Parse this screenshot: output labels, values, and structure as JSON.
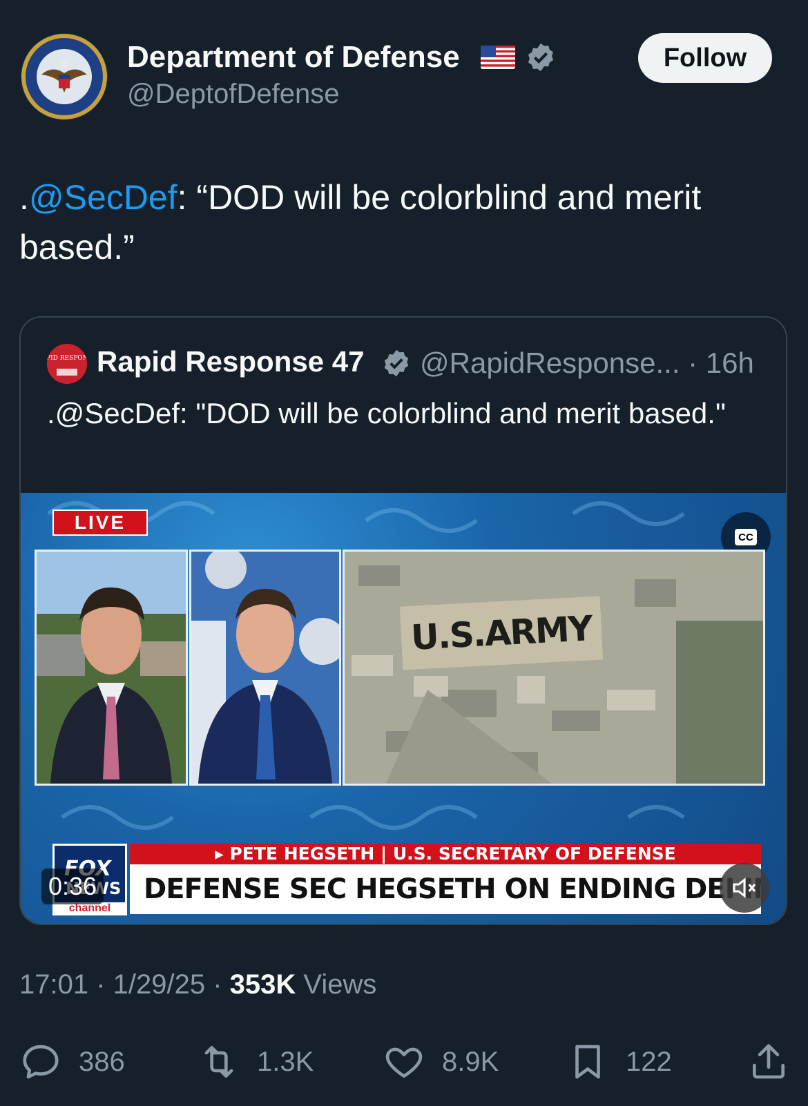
{
  "author": {
    "display_name": "Department of Defense",
    "handle": "@DeptofDefense",
    "follow_label": "Follow"
  },
  "tweet": {
    "prefix": ".",
    "mention": "@SecDef",
    "text": ": “DOD will be colorblind and merit based.”"
  },
  "quoted": {
    "display_name": "Rapid Response 47",
    "handle_time": "@RapidResponse... · 16h",
    "text": ".@SecDef: \"DOD will be colorblind and merit based.\"",
    "avatar_text": "RAPID RESPONSE"
  },
  "video": {
    "live_label": "LIVE",
    "cc_label": "CC",
    "patch_text": "U.S.ARMY",
    "fox_word": "FOX",
    "fox_news": "NEWS",
    "fox_channel": "channel",
    "lower_third_top": "▸ PETE HEGSETH | U.S. SECRETARY OF DEFENSE",
    "lower_third_main": "DEFENSE SEC HEGSETH ON ENDING DEI IN MILITARY",
    "duration": "0:36"
  },
  "meta": {
    "timestamp": "17:01 · 1/29/25 · ",
    "views_count": "353K",
    "views_label": " Views"
  },
  "actions": {
    "replies": "386",
    "retweets": "1.3K",
    "likes": "8.9K",
    "bookmarks": "122"
  },
  "colors": {
    "background": "#15202b",
    "accent": "#1d9bf0",
    "secondary_text": "#8b98a5",
    "verified": "#8b98a5"
  }
}
